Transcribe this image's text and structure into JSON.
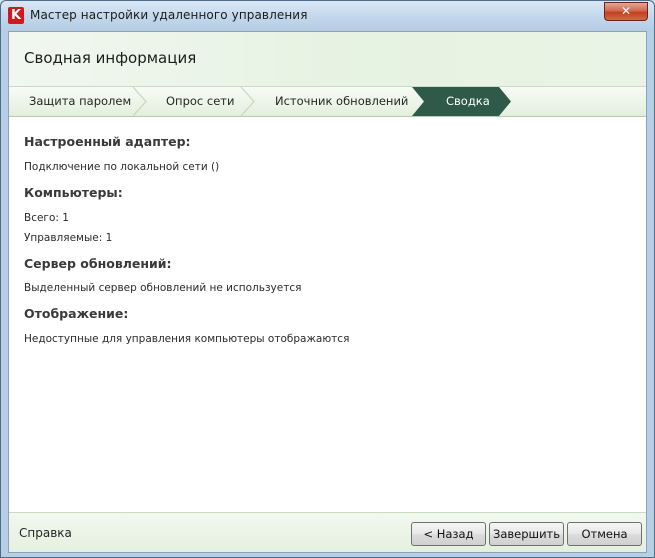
{
  "window": {
    "title": "Мастер настройки удаленного управления",
    "app_icon_letter": "K",
    "close_glyph": "✕"
  },
  "header": {
    "title": "Сводная информация"
  },
  "steps": [
    {
      "label": "Защита паролем",
      "active": false
    },
    {
      "label": "Опрос сети",
      "active": false
    },
    {
      "label": "Источник обновлений",
      "active": false
    },
    {
      "label": "Сводка",
      "active": true
    }
  ],
  "summary": {
    "adapter": {
      "heading": "Настроенный адаптер:",
      "lines": [
        "Подключение по локальной сети ()"
      ]
    },
    "computers": {
      "heading": "Компьютеры:",
      "lines": [
        "Всего: 1",
        "Управляемые: 1"
      ]
    },
    "update_server": {
      "heading": "Сервер обновлений:",
      "lines": [
        "Выделенный сервер обновлений не используется"
      ]
    },
    "display": {
      "heading": "Отображение:",
      "lines": [
        "Недоступные для управления компьютеры отображаются"
      ]
    }
  },
  "footer": {
    "help_label": "Справка",
    "back_label": "< Назад",
    "finish_label": "Завершить",
    "cancel_label": "Отмена"
  },
  "colors": {
    "active_step": "#2f5a4a",
    "header_bg": "#e6f2e2",
    "close_button": "#c2401f"
  }
}
